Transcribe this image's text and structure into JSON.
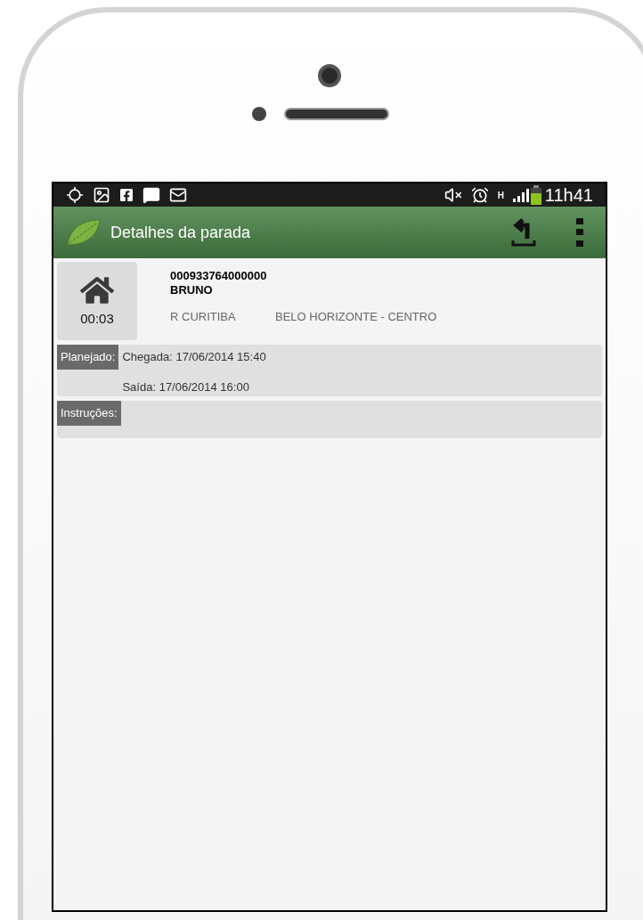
{
  "status_bar": {
    "network_type": "H",
    "time": "11h41"
  },
  "app_bar": {
    "title": "Detalhes da parada"
  },
  "stop": {
    "duration": "00:03",
    "code": "000933764000000",
    "name": "BRUNO",
    "street": "R CURITIBA",
    "city": "BELO HORIZONTE - CENTRO"
  },
  "planned": {
    "label": "Planejado:",
    "lines": [
      "Chegada: 17/06/2014 15:40",
      "Saída: 17/06/2014 16:00"
    ]
  },
  "instructions": {
    "label": "Instruções:"
  }
}
